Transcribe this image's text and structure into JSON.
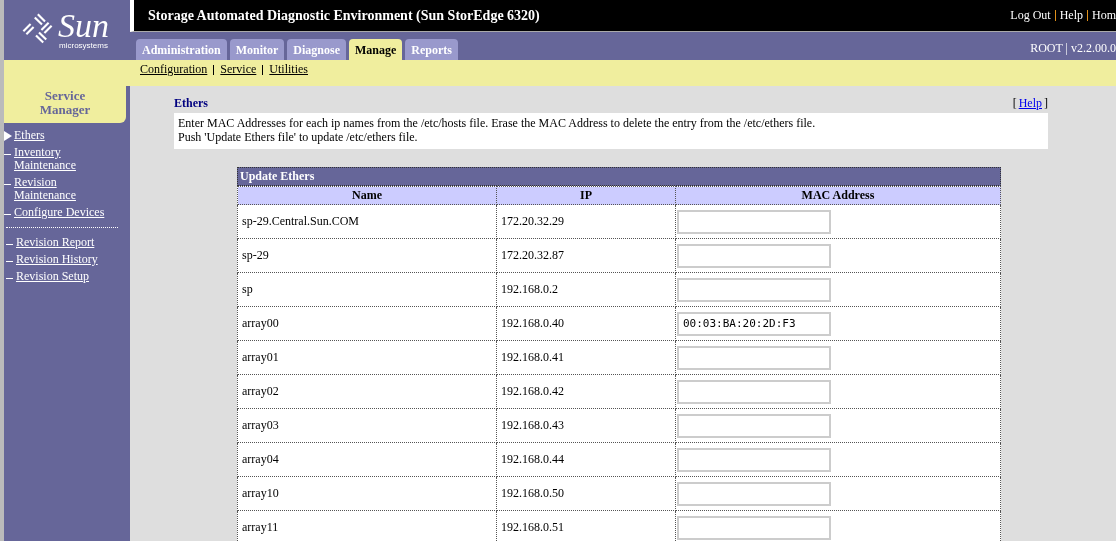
{
  "logo": {
    "name": "Sun",
    "tagline": "microsystems"
  },
  "header": {
    "title": "Storage Automated Diagnostic Environment (Sun StorEdge 6320)",
    "links": [
      "Log Out",
      "Help",
      "Hom"
    ],
    "user_info": "ROOT | v2.2.00.0"
  },
  "tabs": [
    {
      "label": "Administration",
      "selected": false
    },
    {
      "label": "Monitor",
      "selected": false
    },
    {
      "label": "Diagnose",
      "selected": false
    },
    {
      "label": "Manage",
      "selected": true
    },
    {
      "label": "Reports",
      "selected": false
    }
  ],
  "subnav": [
    "Configuration",
    "Service",
    "Utilities"
  ],
  "sidebar": {
    "title": "Service Manager",
    "groups": [
      [
        {
          "label": "Ethers",
          "selected": true
        },
        {
          "label": "Inventory Maintenance",
          "selected": false
        },
        {
          "label": "Revision Maintenance",
          "selected": false
        },
        {
          "label": "Configure Devices",
          "selected": false
        }
      ],
      [
        {
          "label": "Revision Report",
          "selected": false
        },
        {
          "label": "Revision History",
          "selected": false
        },
        {
          "label": "Revision Setup",
          "selected": false
        }
      ]
    ]
  },
  "page": {
    "title": "Ethers",
    "help_open": "[",
    "help_link": "Help",
    "help_close": "]",
    "description": [
      "Enter MAC Addresses for each ip names from the /etc/hosts file. Erase the MAC Address to delete the entry from the /etc/ethers file.",
      "Push 'Update Ethers file' to update /etc/ethers file."
    ]
  },
  "table": {
    "title": "Update Ethers",
    "columns": [
      "Name",
      "IP",
      "MAC Address"
    ],
    "rows": [
      {
        "name": "sp-29.Central.Sun.COM",
        "ip": "172.20.32.29",
        "mac": ""
      },
      {
        "name": "sp-29",
        "ip": "172.20.32.87",
        "mac": ""
      },
      {
        "name": "sp",
        "ip": "192.168.0.2",
        "mac": ""
      },
      {
        "name": "array00",
        "ip": "192.168.0.40",
        "mac": "00:03:BA:20:2D:F3"
      },
      {
        "name": "array01",
        "ip": "192.168.0.41",
        "mac": ""
      },
      {
        "name": "array02",
        "ip": "192.168.0.42",
        "mac": ""
      },
      {
        "name": "array03",
        "ip": "192.168.0.43",
        "mac": ""
      },
      {
        "name": "array04",
        "ip": "192.168.0.44",
        "mac": ""
      },
      {
        "name": "array10",
        "ip": "192.168.0.50",
        "mac": ""
      },
      {
        "name": "array11",
        "ip": "192.168.0.51",
        "mac": ""
      }
    ]
  }
}
